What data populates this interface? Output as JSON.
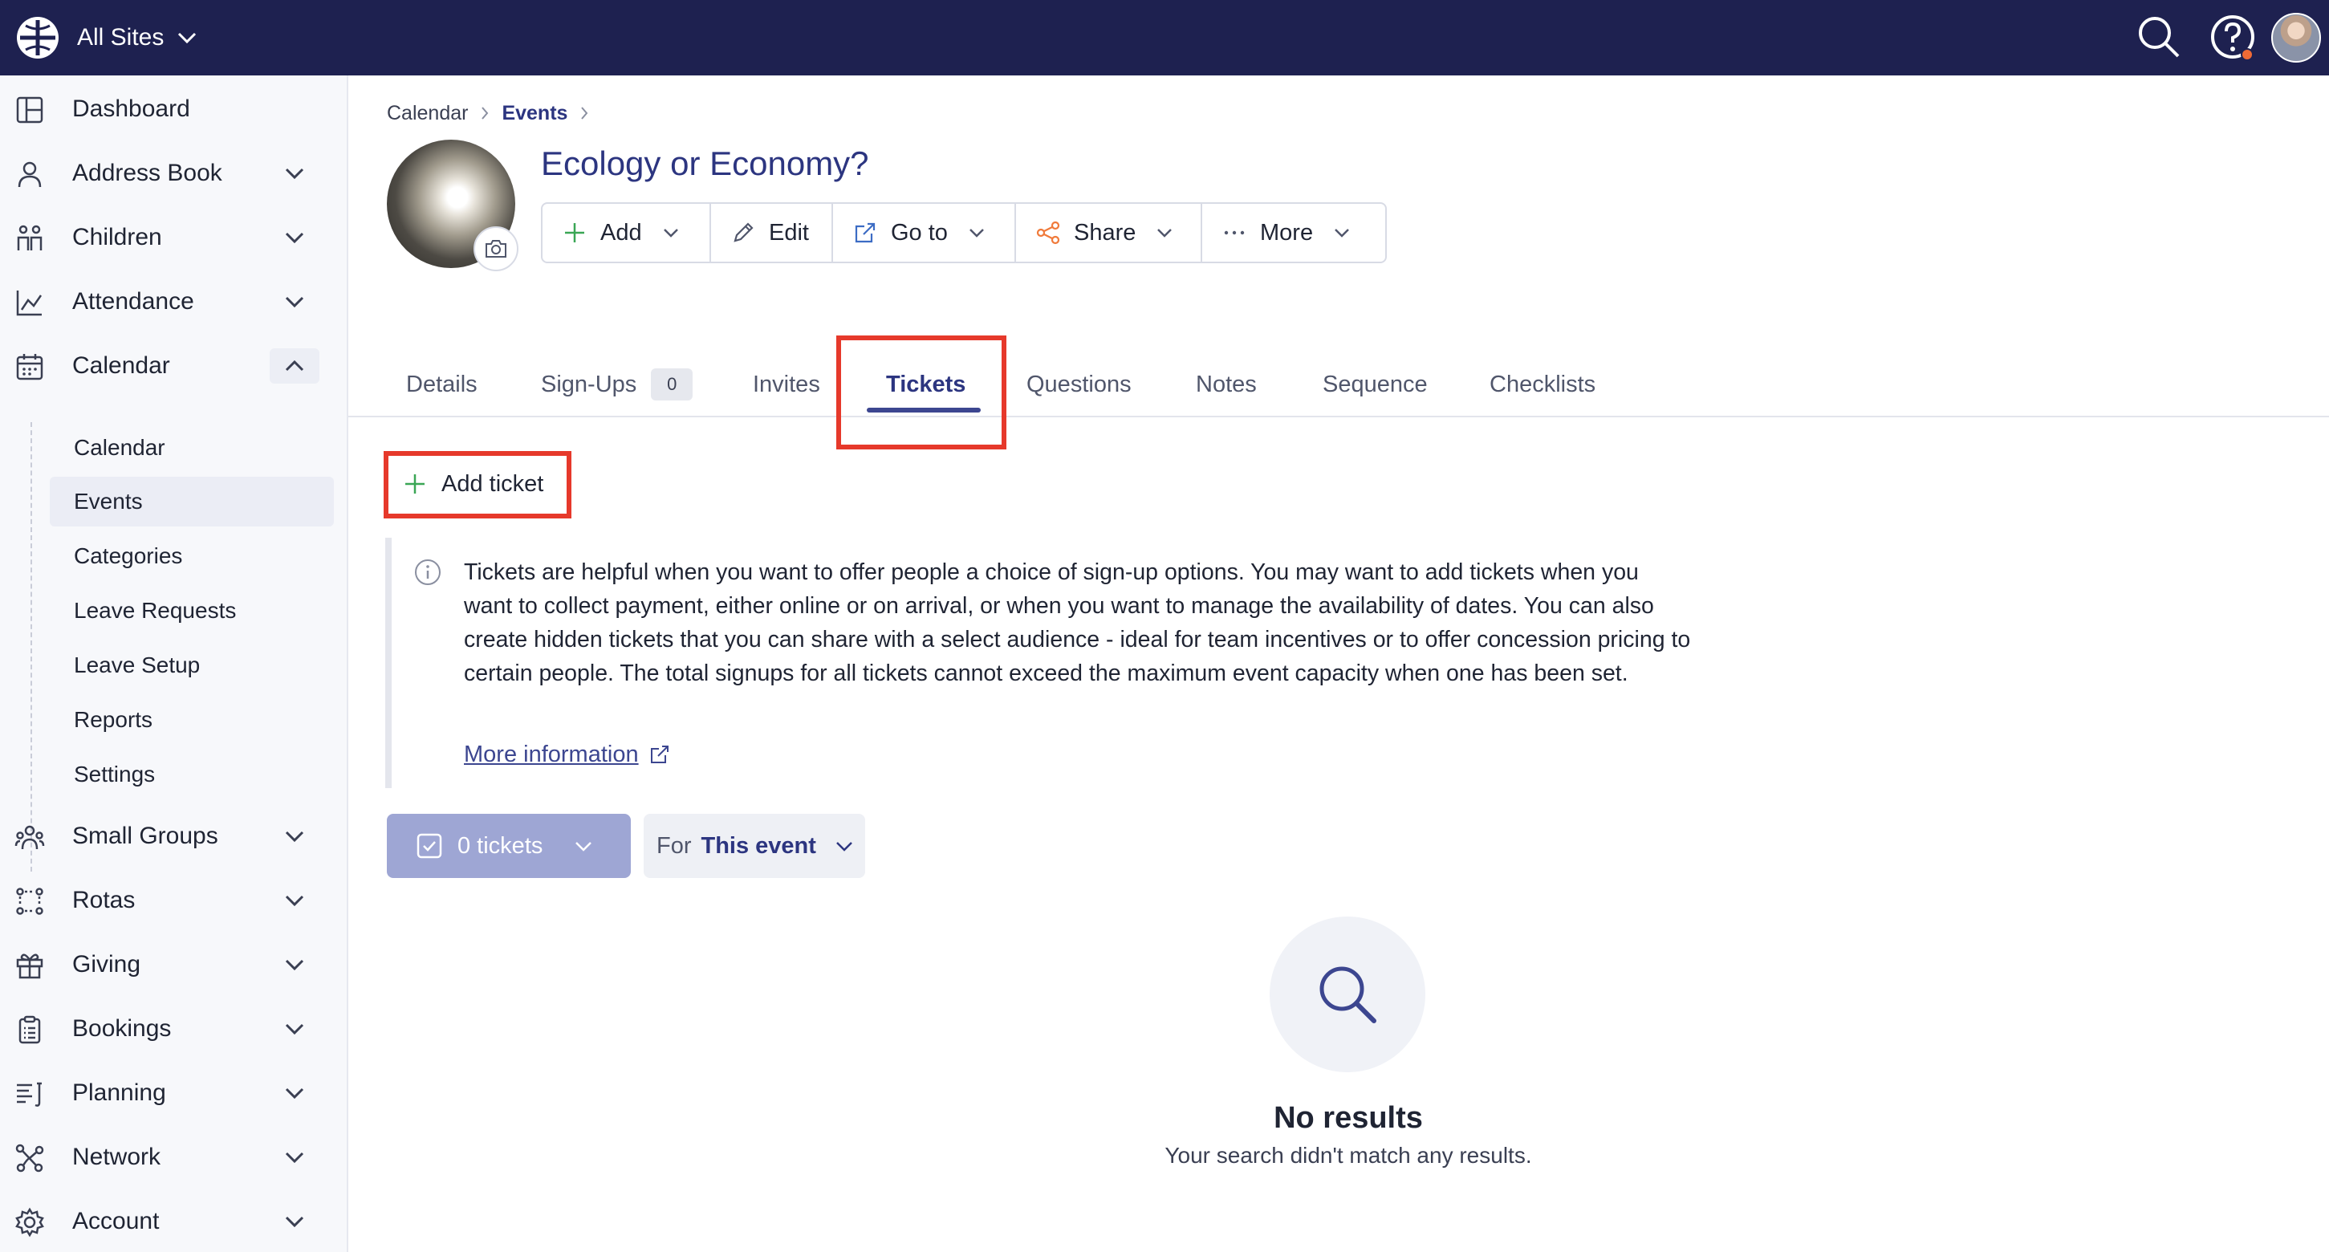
{
  "topbar": {
    "site_switch": "All Sites"
  },
  "sidebar": {
    "items": [
      {
        "label": "Dashboard"
      },
      {
        "label": "Address Book"
      },
      {
        "label": "Children"
      },
      {
        "label": "Attendance"
      },
      {
        "label": "Calendar"
      },
      {
        "label": "Small Groups"
      },
      {
        "label": "Rotas"
      },
      {
        "label": "Giving"
      },
      {
        "label": "Bookings"
      },
      {
        "label": "Planning"
      },
      {
        "label": "Network"
      },
      {
        "label": "Account"
      }
    ],
    "calendar_sub": [
      {
        "label": "Calendar"
      },
      {
        "label": "Events"
      },
      {
        "label": "Categories"
      },
      {
        "label": "Leave Requests"
      },
      {
        "label": "Leave Setup"
      },
      {
        "label": "Reports"
      },
      {
        "label": "Settings"
      }
    ]
  },
  "breadcrumb": [
    "Calendar",
    "Events"
  ],
  "event": {
    "title": "Ecology or Economy?"
  },
  "actions": {
    "add": "Add",
    "edit": "Edit",
    "goto": "Go to",
    "share": "Share",
    "more": "More"
  },
  "tabs": {
    "details": "Details",
    "signups": "Sign-Ups",
    "signups_count": "0",
    "invites": "Invites",
    "tickets": "Tickets",
    "questions": "Questions",
    "notes": "Notes",
    "sequence": "Sequence",
    "checklists": "Checklists"
  },
  "tickets": {
    "add_label": "Add ticket",
    "info_text": "Tickets are helpful when you want to offer people a choice of sign-up options. You may want to add tickets when you want to collect payment, either online or on arrival, or when you want to manage the availability of dates. You can also create hidden tickets that you can share with a select audience - ideal for team incentives or to offer concession pricing to certain people. The total signups for all tickets cannot exceed the maximum event capacity when one has been set.",
    "more_info": "More information",
    "count_label": "0 tickets",
    "for_prefix": "For",
    "for_value": "This event"
  },
  "empty": {
    "title": "No results",
    "subtitle": "Your search didn't match any results."
  },
  "colors": {
    "topbar": "#1e2150",
    "accent": "#2c3580",
    "highlight": "#e6392b",
    "plus_green": "#3aa655",
    "share_orange": "#f07a3a"
  }
}
